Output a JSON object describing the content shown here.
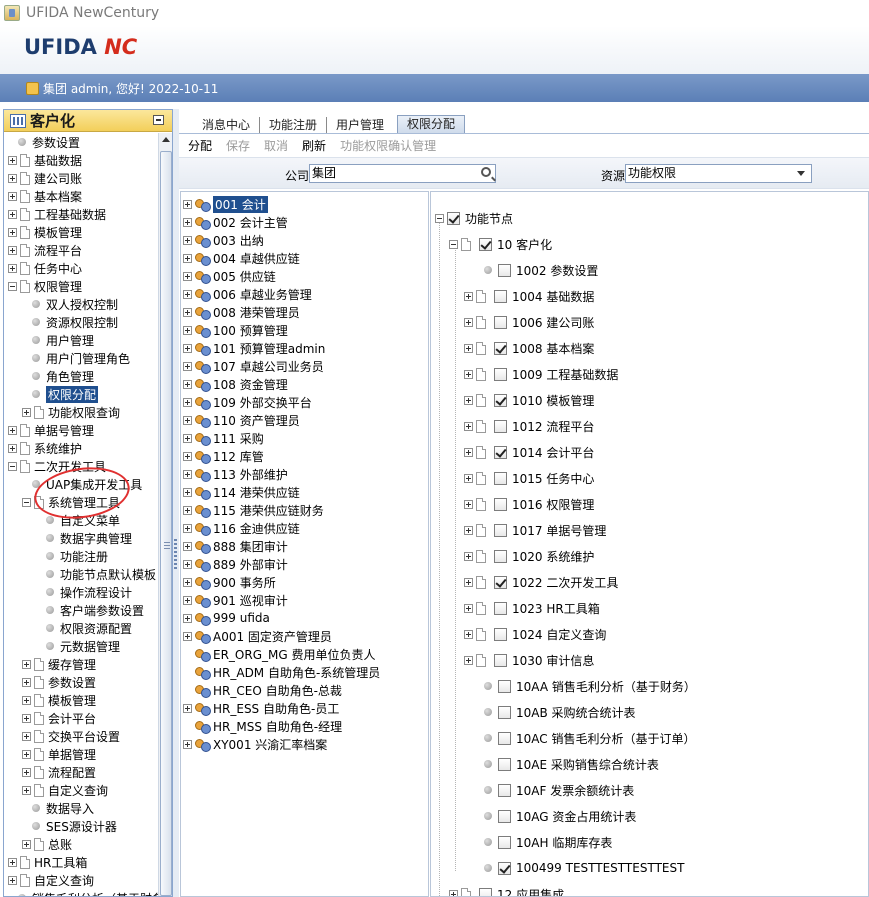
{
  "window": {
    "title": "UFIDA NewCentury"
  },
  "brand": {
    "logo_main": "UFIDA",
    "logo_nc": "NC"
  },
  "userbar": {
    "greeting": "集团 admin, 您好! 2022-10-11"
  },
  "left_panel": {
    "title": "客户化",
    "items": [
      {
        "label": "参数设置",
        "level": 0,
        "type": "leaf"
      },
      {
        "label": "基础数据",
        "level": 0,
        "type": "folder"
      },
      {
        "label": "建公司账",
        "level": 0,
        "type": "folder"
      },
      {
        "label": "基本档案",
        "level": 0,
        "type": "folder"
      },
      {
        "label": "工程基础数据",
        "level": 0,
        "type": "folder"
      },
      {
        "label": "模板管理",
        "level": 0,
        "type": "folder"
      },
      {
        "label": "流程平台",
        "level": 0,
        "type": "folder"
      },
      {
        "label": "任务中心",
        "level": 0,
        "type": "folder"
      },
      {
        "label": "权限管理",
        "level": 0,
        "type": "open"
      },
      {
        "label": "双人授权控制",
        "level": 1,
        "type": "leaf"
      },
      {
        "label": "资源权限控制",
        "level": 1,
        "type": "leaf"
      },
      {
        "label": "用户管理",
        "level": 1,
        "type": "leaf"
      },
      {
        "label": "用户门管理角色",
        "level": 1,
        "type": "leaf"
      },
      {
        "label": "角色管理",
        "level": 1,
        "type": "leaf"
      },
      {
        "label": "权限分配",
        "level": 1,
        "type": "leaf",
        "selected": true
      },
      {
        "label": "功能权限查询",
        "level": 1,
        "type": "folder"
      },
      {
        "label": "单据号管理",
        "level": 0,
        "type": "folder"
      },
      {
        "label": "系统维护",
        "level": 0,
        "type": "folder"
      },
      {
        "label": "二次开发工具",
        "level": 0,
        "type": "open"
      },
      {
        "label": "UAP集成开发工具",
        "level": 1,
        "type": "leaf"
      },
      {
        "label": "系统管理工具",
        "level": 1,
        "type": "open"
      },
      {
        "label": "自定义菜单",
        "level": 2,
        "type": "leaf"
      },
      {
        "label": "数据字典管理",
        "level": 2,
        "type": "leaf"
      },
      {
        "label": "功能注册",
        "level": 2,
        "type": "leaf"
      },
      {
        "label": "功能节点默认模板",
        "level": 2,
        "type": "leaf"
      },
      {
        "label": "操作流程设计",
        "level": 2,
        "type": "leaf"
      },
      {
        "label": "客户端参数设置",
        "level": 2,
        "type": "leaf"
      },
      {
        "label": "权限资源配置",
        "level": 2,
        "type": "leaf"
      },
      {
        "label": "元数据管理",
        "level": 2,
        "type": "leaf"
      },
      {
        "label": "缓存管理",
        "level": 1,
        "type": "folder"
      },
      {
        "label": "参数设置",
        "level": 1,
        "type": "folder"
      },
      {
        "label": "模板管理",
        "level": 1,
        "type": "folder"
      },
      {
        "label": "会计平台",
        "level": 1,
        "type": "folder"
      },
      {
        "label": "交换平台设置",
        "level": 1,
        "type": "folder"
      },
      {
        "label": "单据管理",
        "level": 1,
        "type": "folder"
      },
      {
        "label": "流程配置",
        "level": 1,
        "type": "folder"
      },
      {
        "label": "自定义查询",
        "level": 1,
        "type": "folder"
      },
      {
        "label": "数据导入",
        "level": 1,
        "type": "leaf"
      },
      {
        "label": "SES源设计器",
        "level": 1,
        "type": "leaf"
      },
      {
        "label": "总账",
        "level": 1,
        "type": "folder"
      },
      {
        "label": "HR工具箱",
        "level": 0,
        "type": "folder"
      },
      {
        "label": "自定义查询",
        "level": 0,
        "type": "folder"
      },
      {
        "label": "销售毛利分析（基于财务）",
        "level": 0,
        "type": "leaf"
      }
    ]
  },
  "tabs": [
    {
      "label": "消息中心"
    },
    {
      "label": "功能注册"
    },
    {
      "label": "用户管理"
    },
    {
      "label": "权限分配",
      "active": true
    }
  ],
  "toolbar": {
    "assign": "分配",
    "save": "保存",
    "cancel": "取消",
    "refresh": "刷新",
    "confirm": "功能权限确认管理"
  },
  "filter": {
    "company_label": "公司",
    "company_value": "集团",
    "resource_label": "资源",
    "resource_value": "功能权限"
  },
  "roles": [
    {
      "label": "001 会计",
      "expand": true,
      "selected": true
    },
    {
      "label": "002 会计主管",
      "expand": true
    },
    {
      "label": "003 出纳",
      "expand": true
    },
    {
      "label": "004 卓越供应链",
      "expand": true
    },
    {
      "label": "005 供应链",
      "expand": true
    },
    {
      "label": "006 卓越业务管理",
      "expand": true
    },
    {
      "label": "008 港荣管理员",
      "expand": true
    },
    {
      "label": "100 预算管理",
      "expand": true
    },
    {
      "label": "101 预算管理admin",
      "expand": true
    },
    {
      "label": "107 卓越公司业务员",
      "expand": true
    },
    {
      "label": "108 资金管理",
      "expand": true
    },
    {
      "label": "109 外部交换平台",
      "expand": true
    },
    {
      "label": "110 资产管理员",
      "expand": true
    },
    {
      "label": "111 采购",
      "expand": true
    },
    {
      "label": "112 库管",
      "expand": true
    },
    {
      "label": "113 外部维护",
      "expand": true
    },
    {
      "label": "114 港荣供应链",
      "expand": true
    },
    {
      "label": "115 港荣供应链财务",
      "expand": true
    },
    {
      "label": "116 金迪供应链",
      "expand": true
    },
    {
      "label": "888 集团审计",
      "expand": true
    },
    {
      "label": "889 外部审计",
      "expand": true
    },
    {
      "label": "900 事务所",
      "expand": true
    },
    {
      "label": "901 巡视审计",
      "expand": true
    },
    {
      "label": "999 ufida",
      "expand": true
    },
    {
      "label": "A001 固定资产管理员",
      "expand": true
    },
    {
      "label": "ER_ORG_MG 费用单位负责人",
      "expand": false
    },
    {
      "label": "HR_ADM 自助角色-系统管理员",
      "expand": false
    },
    {
      "label": "HR_CEO 自助角色-总裁",
      "expand": false
    },
    {
      "label": "HR_ESS 自助角色-员工",
      "expand": true
    },
    {
      "label": "HR_MSS 自助角色-经理",
      "expand": false
    },
    {
      "label": "XY001 兴渝汇率档案",
      "expand": true
    }
  ],
  "func_tree": {
    "root": "功能节点",
    "group": "10 客户化",
    "items": [
      {
        "label": "1002 参数设置",
        "kind": "leaf",
        "checked": false
      },
      {
        "label": "1004 基础数据",
        "kind": "folder",
        "checked": false
      },
      {
        "label": "1006 建公司账",
        "kind": "folder",
        "checked": false
      },
      {
        "label": "1008 基本档案",
        "kind": "folder",
        "checked": true
      },
      {
        "label": "1009 工程基础数据",
        "kind": "folder",
        "checked": false
      },
      {
        "label": "1010 模板管理",
        "kind": "folder",
        "checked": true
      },
      {
        "label": "1012 流程平台",
        "kind": "folder",
        "checked": false
      },
      {
        "label": "1014 会计平台",
        "kind": "folder",
        "checked": true
      },
      {
        "label": "1015 任务中心",
        "kind": "folder",
        "checked": false
      },
      {
        "label": "1016 权限管理",
        "kind": "folder",
        "checked": false
      },
      {
        "label": "1017 单据号管理",
        "kind": "folder",
        "checked": false
      },
      {
        "label": "1020 系统维护",
        "kind": "folder",
        "checked": false
      },
      {
        "label": "1022 二次开发工具",
        "kind": "folder",
        "checked": true
      },
      {
        "label": "1023 HR工具箱",
        "kind": "folder",
        "checked": false
      },
      {
        "label": "1024 自定义查询",
        "kind": "folder",
        "checked": false
      },
      {
        "label": "1030 审计信息",
        "kind": "folder",
        "checked": false
      },
      {
        "label": "10AA 销售毛利分析（基于财务）",
        "kind": "leaf",
        "checked": false
      },
      {
        "label": "10AB 采购统合统计表",
        "kind": "leaf",
        "checked": false
      },
      {
        "label": "10AC 销售毛利分析（基于订单）",
        "kind": "leaf",
        "checked": false
      },
      {
        "label": "10AE 采购销售综合统计表",
        "kind": "leaf",
        "checked": false
      },
      {
        "label": "10AF 发票余额统计表",
        "kind": "leaf",
        "checked": false
      },
      {
        "label": "10AG 资金占用统计表",
        "kind": "leaf",
        "checked": false
      },
      {
        "label": "10AH 临期库存表",
        "kind": "leaf",
        "checked": false
      },
      {
        "label": "100499 TESTTESTTESTTEST",
        "kind": "leaf",
        "checked": true
      }
    ],
    "next_group": "12 应用集成"
  }
}
